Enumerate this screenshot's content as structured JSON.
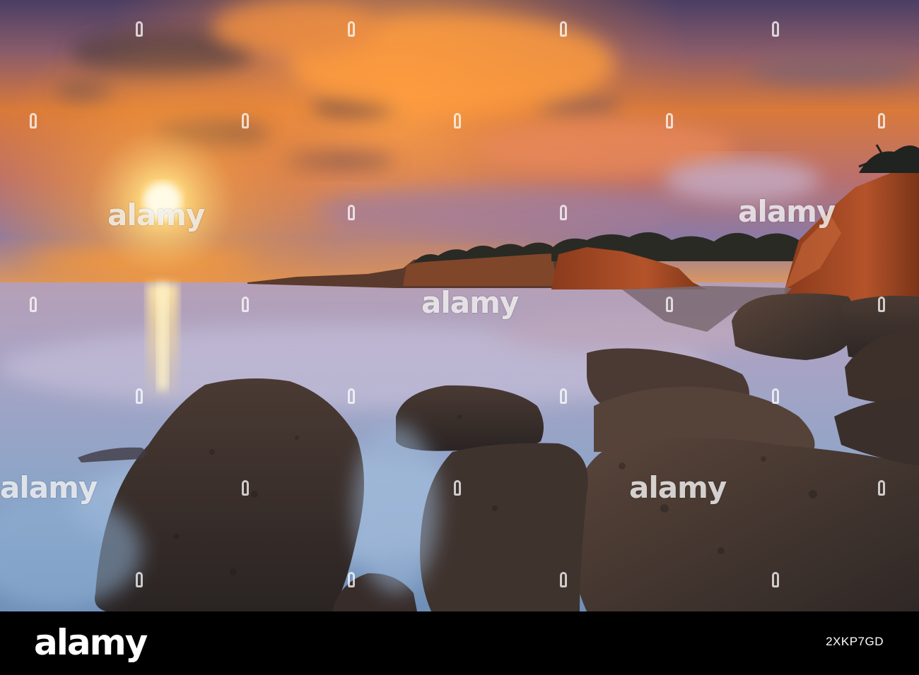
{
  "watermark": {
    "text": "alamy",
    "center": "alamy",
    "left": "alamy",
    "right": "alamy",
    "mid_right": "alamy",
    "top_left": "alamy"
  },
  "footer": {
    "brand": "alamy",
    "image_id": "2XKP7GD"
  },
  "colors": {
    "sky_top": "#5a4b78",
    "sun": "#fff3c4",
    "sky_orange": "#f08a2c",
    "sea": "#8fa6c6",
    "rock": "#3a2f2b",
    "cliff": "#b4532a"
  }
}
